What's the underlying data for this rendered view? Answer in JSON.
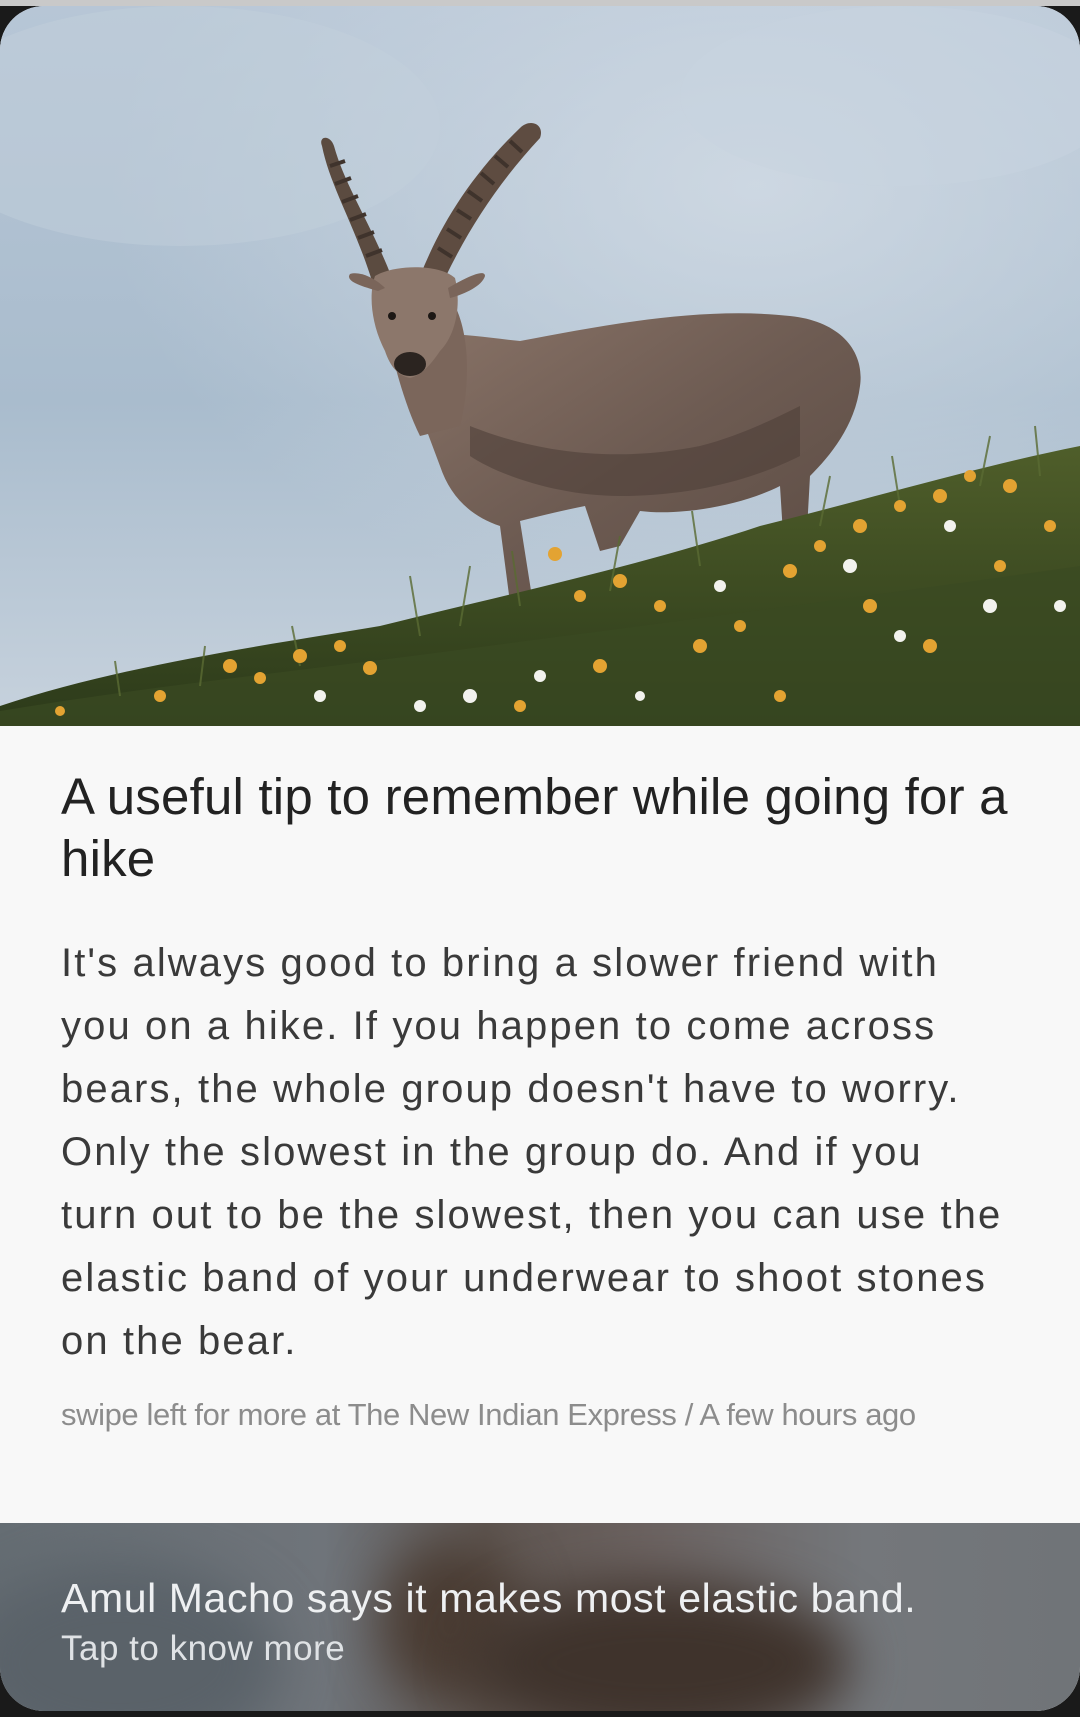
{
  "article": {
    "image_alt": "Ibex standing on a flowery hillside",
    "headline": "A useful tip to remember while going for a hike",
    "body": "It's always good to bring a slower friend with you on a hike. If you happen to come across bears, the whole group doesn't have to worry. Only the slowest in the group do. And if you turn out to be the slowest, then you can use the elastic band of your underwear to shoot stones on the bear.",
    "footer": "swipe left for more at The New Indian Express / A few hours ago"
  },
  "ad": {
    "title": "Amul Macho says it makes most elastic band.",
    "subtitle": "Tap to know more"
  },
  "colors": {
    "card_background": "#f8f8f8",
    "headline": "#222222",
    "body": "#3a3a3a",
    "footer": "#8c8c8c",
    "sky": "#a9bccd"
  }
}
